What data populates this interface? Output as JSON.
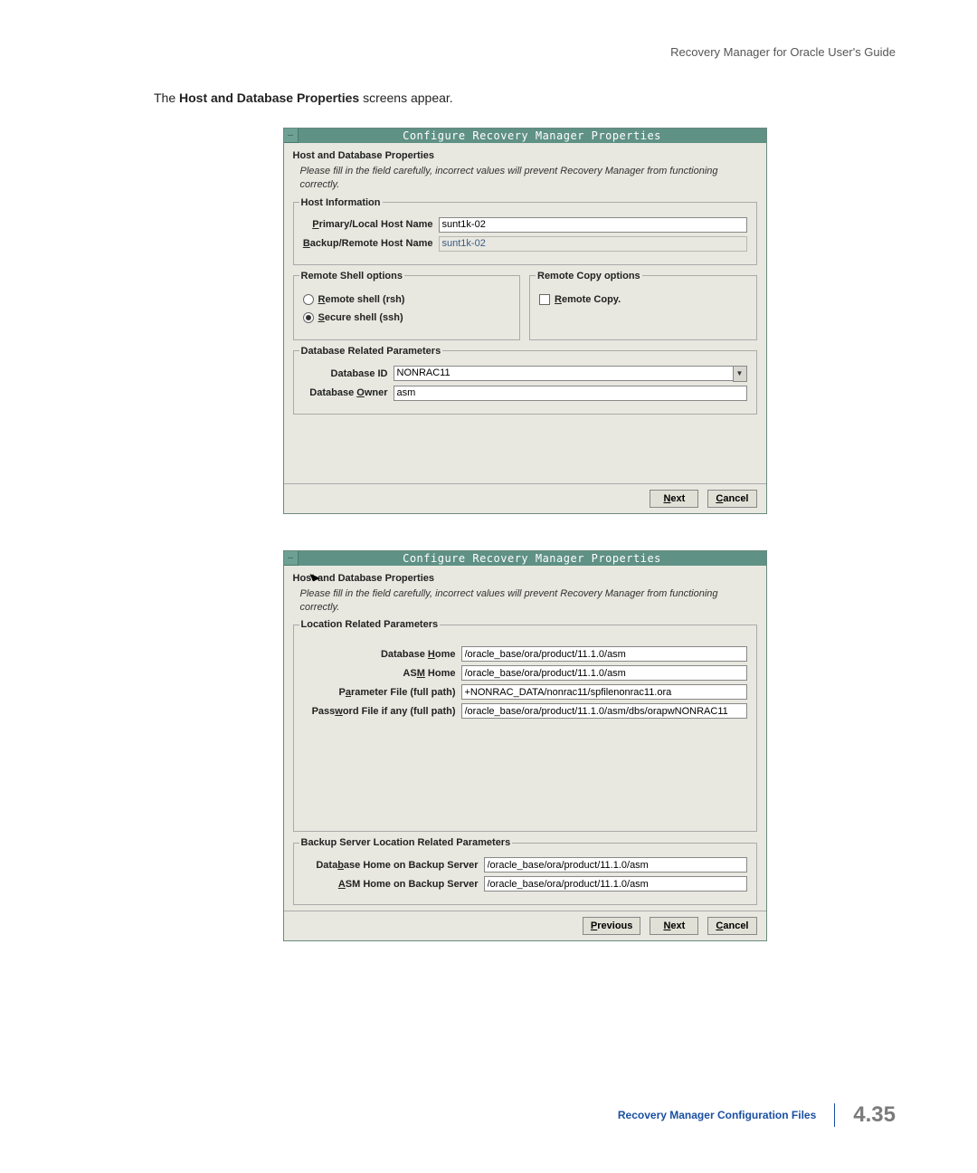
{
  "header": {
    "doc_title": "Recovery Manager for Oracle User's Guide"
  },
  "intro": {
    "prefix": "The ",
    "bold": "Host and Database Properties",
    "suffix": " screens appear."
  },
  "dialog1": {
    "window_title": "Configure Recovery Manager Properties",
    "section_title": "Host and Database Properties",
    "section_desc": "Please fill in the field carefully, incorrect values will prevent Recovery Manager from functioning correctly.",
    "host_info": {
      "legend": "Host Information",
      "primary_label": "Primary/Local Host Name",
      "primary_value": "sunt1k-02",
      "backup_label": "Backup/Remote Host Name",
      "backup_value": "sunt1k-02"
    },
    "remote_shell": {
      "legend": "Remote Shell options",
      "opt1": "Remote shell (rsh)",
      "opt2": "Secure shell (ssh)"
    },
    "remote_copy": {
      "legend": "Remote Copy options",
      "opt1": "Remote Copy."
    },
    "db_params": {
      "legend": "Database Related Parameters",
      "id_label": "Database ID",
      "id_value": "NONRAC11",
      "owner_label": "Database Owner",
      "owner_value": "asm"
    },
    "buttons": {
      "next": "Next",
      "cancel": "Cancel"
    }
  },
  "dialog2": {
    "window_title": "Configure Recovery Manager Properties",
    "section_title": "Host and Database Properties",
    "section_desc": "Please fill in the field carefully, incorrect values will prevent Recovery Manager from functioning correctly.",
    "loc_params": {
      "legend": "Location Related Parameters",
      "dbhome_label": "Database Home",
      "dbhome_value": "/oracle_base/ora/product/11.1.0/asm",
      "asmhome_label": "ASM Home",
      "asmhome_value": "/oracle_base/ora/product/11.1.0/asm",
      "param_label": "Parameter File (full path)",
      "param_value": "+NONRAC_DATA/nonrac11/spfilenonrac11.ora",
      "pwd_label": "Password File if any (full path)",
      "pwd_value": "/oracle_base/ora/product/11.1.0/asm/dbs/orapwNONRAC11"
    },
    "backup_loc": {
      "legend": "Backup Server Location Related Parameters",
      "dbhome_label": "Database Home on Backup Server",
      "dbhome_value": "/oracle_base/ora/product/11.1.0/asm",
      "asmhome_label": "ASM Home on Backup Server",
      "asmhome_value": "/oracle_base/ora/product/11.1.0/asm"
    },
    "buttons": {
      "previous": "Previous",
      "next": "Next",
      "cancel": "Cancel"
    }
  },
  "footer": {
    "link": "Recovery Manager Configuration Files",
    "page": "4.35"
  }
}
